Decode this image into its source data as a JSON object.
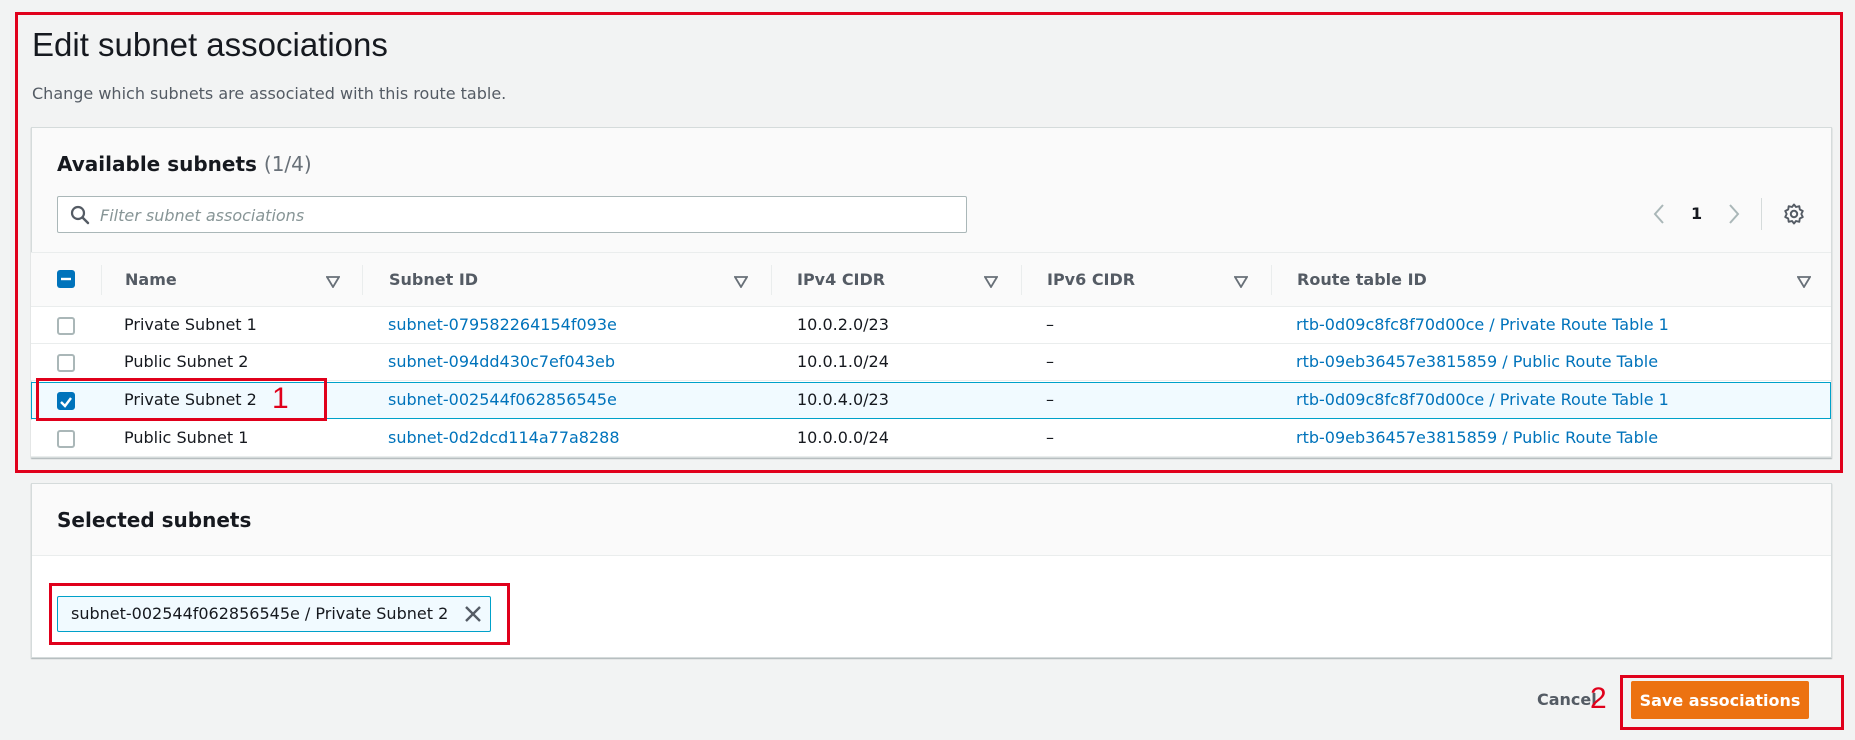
{
  "page": {
    "title": "Edit subnet associations",
    "description": "Change which subnets are associated with this route table."
  },
  "available": {
    "title": "Available subnets",
    "count": "(1/4)",
    "search_placeholder": "Filter subnet associations",
    "page_number": "1",
    "columns": [
      "Name",
      "Subnet ID",
      "IPv4 CIDR",
      "IPv6 CIDR",
      "Route table ID"
    ],
    "rows": [
      {
        "name": "Private Subnet 1",
        "subnet_id": "subnet-079582264154f093e",
        "ipv4": "10.0.2.0/23",
        "ipv6": "–",
        "route_table": "rtb-0d09c8fc8f70d00ce / Private Route Table 1",
        "checked": false
      },
      {
        "name": "Public Subnet 2",
        "subnet_id": "subnet-094dd430c7ef043eb",
        "ipv4": "10.0.1.0/24",
        "ipv6": "–",
        "route_table": "rtb-09eb36457e3815859 / Public Route Table",
        "checked": false
      },
      {
        "name": "Private Subnet 2",
        "subnet_id": "subnet-002544f062856545e",
        "ipv4": "10.0.4.0/23",
        "ipv6": "–",
        "route_table": "rtb-0d09c8fc8f70d00ce / Private Route Table 1",
        "checked": true
      },
      {
        "name": "Public Subnet 1",
        "subnet_id": "subnet-0d2dcd114a77a8288",
        "ipv4": "10.0.0.0/24",
        "ipv6": "–",
        "route_table": "rtb-09eb36457e3815859 / Public Route Table",
        "checked": false
      }
    ]
  },
  "selected": {
    "title": "Selected subnets",
    "tokens": [
      "subnet-002544f062856545e / Private Subnet 2"
    ]
  },
  "footer": {
    "cancel_label": "Cancel",
    "save_label": "Save associations"
  },
  "annotations": {
    "step1": "1",
    "step2": "2"
  },
  "colors": {
    "accent": "#0073bb",
    "primary_button": "#ec7211",
    "annotation": "#e0001b"
  },
  "icons": [
    "search-icon",
    "chevron-left-icon",
    "chevron-right-icon",
    "gear-icon",
    "sort-icon",
    "close-icon",
    "checkmark-icon",
    "minus-icon"
  ]
}
